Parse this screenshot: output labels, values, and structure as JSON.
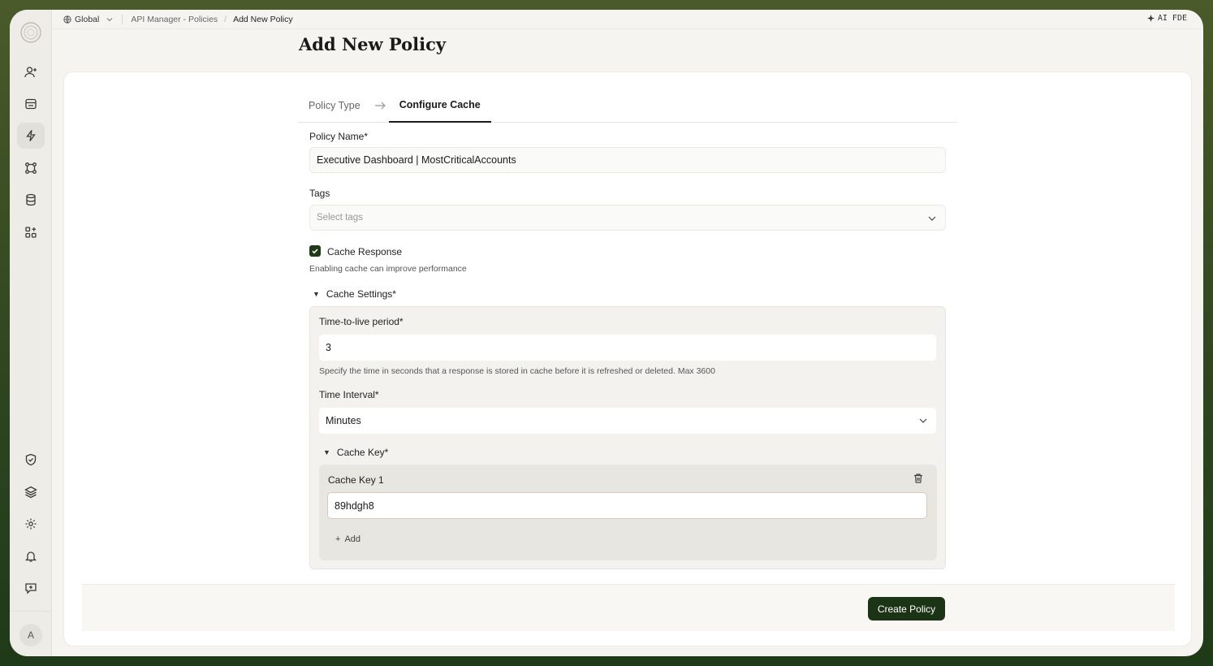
{
  "breadcrumb": {
    "scope": "Global",
    "section": "API Manager - Policies",
    "current": "Add New Policy"
  },
  "top_right_label": "AI FDE",
  "page_title": "Add New Policy",
  "tabs": [
    {
      "label": "Policy Type",
      "active": false
    },
    {
      "label": "Configure Cache",
      "active": true
    }
  ],
  "form": {
    "policy_name_label": "Policy Name*",
    "policy_name_value": "Executive Dashboard | MostCriticalAccounts",
    "tags_label": "Tags",
    "tags_placeholder": "Select tags",
    "cache_response_label": "Cache Response",
    "cache_response_checked": true,
    "cache_hint": "Enabling cache can improve performance",
    "cache_settings_label": "Cache Settings*",
    "ttl_label": "Time-to-live period*",
    "ttl_value": "3",
    "ttl_hint": "Specify the time in seconds that a response is stored in cache before it is refreshed or deleted. Max 3600",
    "interval_label": "Time Interval*",
    "interval_value": "Minutes",
    "cache_key_section_label": "Cache Key*",
    "cache_keys": [
      {
        "label": "Cache Key 1",
        "value": "89hdgh8"
      }
    ],
    "add_label": "Add"
  },
  "footer": {
    "create_label": "Create Policy"
  },
  "user_initial": "A",
  "colors": {
    "accent": "#1c3416",
    "background": "#f5f4f0"
  }
}
